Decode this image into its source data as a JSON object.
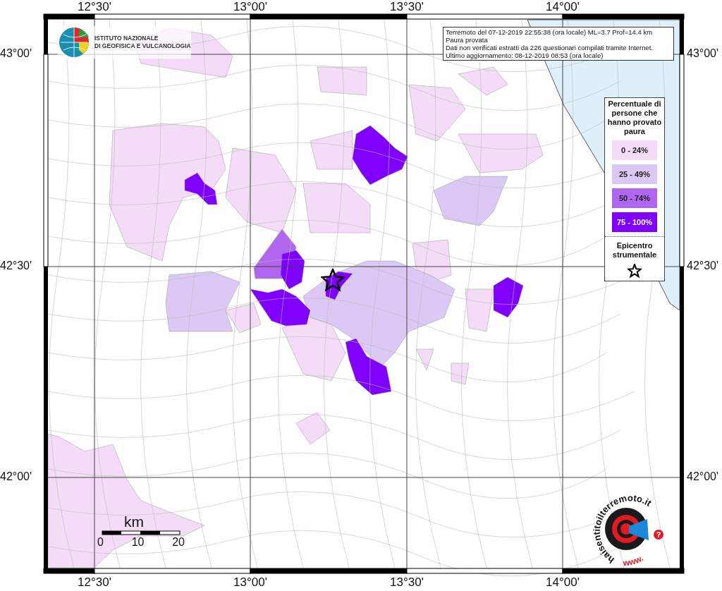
{
  "map": {
    "x_ticks_top": [
      "12°30'",
      "13°00'",
      "13°30'",
      "14°00'"
    ],
    "x_ticks_bottom": [
      "12°30'",
      "13°00'",
      "13°30'",
      "14°00'"
    ],
    "y_ticks_left": [
      "43°00'",
      "42°30'",
      "42°00'"
    ],
    "y_ticks_right": [
      "43°00'",
      "42°30'",
      "42°00'"
    ]
  },
  "institute_logo": {
    "lines": [
      "ISTITUTO NAZIONALE",
      "DI GEOFISICA E VULCANOLOGIA"
    ]
  },
  "info": {
    "lines": [
      "Terremoto del 07-12-2019 22:55:38 (ora locale) ML=3.7 Prof=14.4 km",
      "Paura provata",
      "Dati non verificati estratti da 226 questionari compilati tramite Internet.",
      "Ultimo aggiornamento: 08-12-2019 08:53 (ora locale)"
    ]
  },
  "legend": {
    "title": "Percentuale di persone che hanno provato paura",
    "classes": [
      {
        "label": "0 - 24%",
        "color": "#f4dcf8"
      },
      {
        "label": "25 - 49%",
        "color": "#dcc8f5"
      },
      {
        "label": "50 - 74%",
        "color": "#b066ee"
      },
      {
        "label": "75 - 100%",
        "color": "#7f00ff"
      }
    ],
    "epicenter_label": "Epicentro strumentale"
  },
  "scale": {
    "unit": "km",
    "ticks": [
      "0",
      "10",
      "20"
    ]
  },
  "site_logo": {
    "arc_text": "haisentitoilterremoto.it",
    "www": "www.",
    "question": "?"
  }
}
